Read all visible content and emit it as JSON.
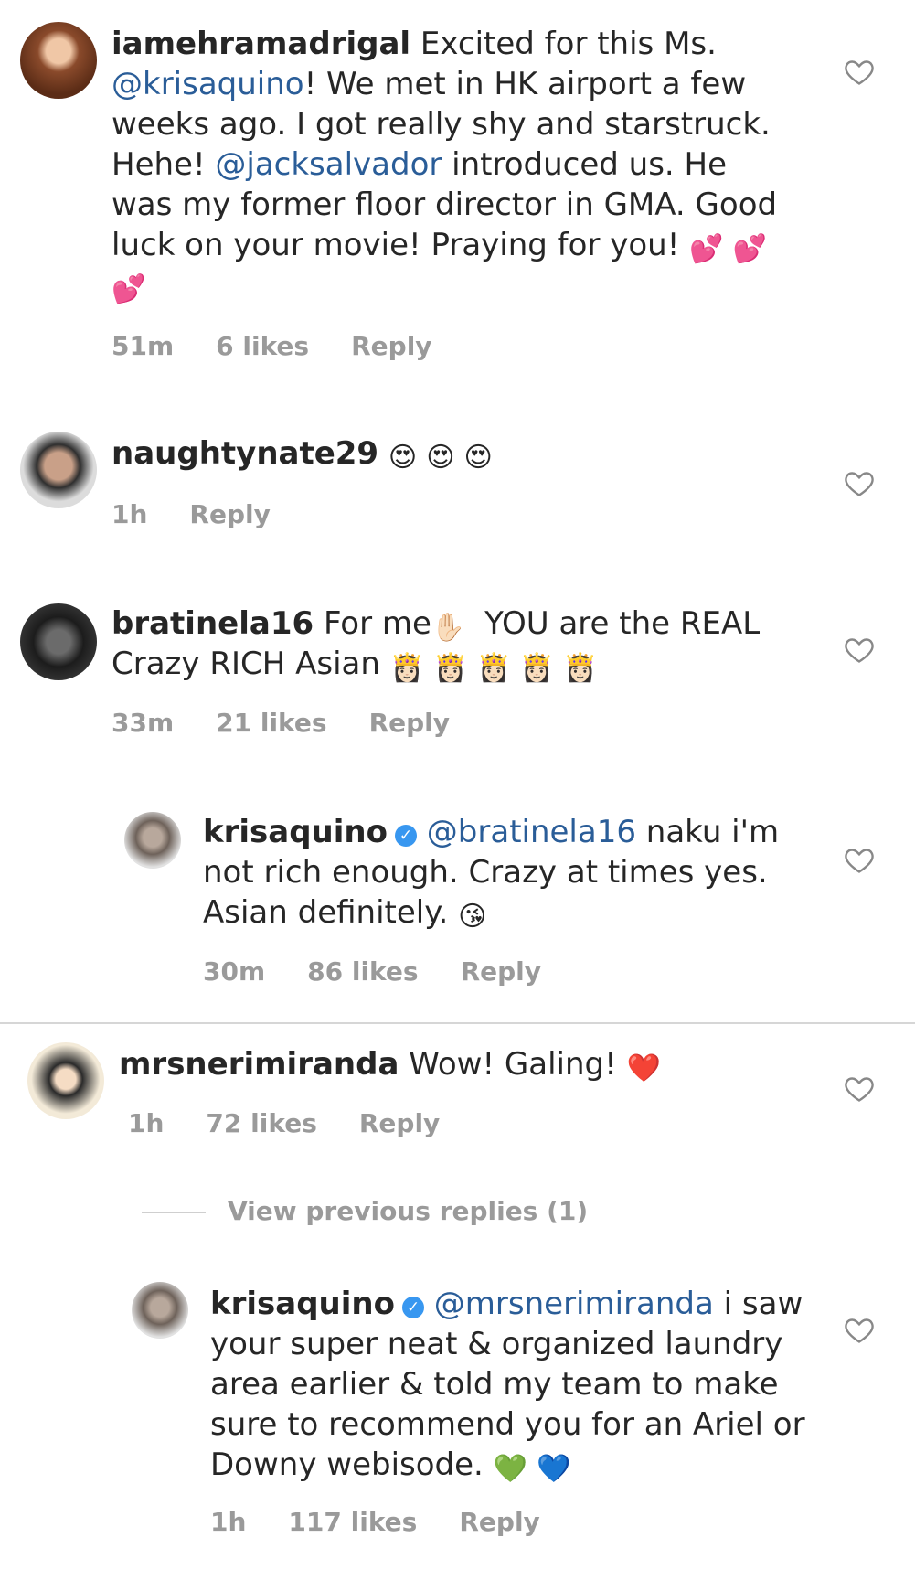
{
  "comments": [
    {
      "username": "iamehramadrigal",
      "text_a": " Excited for this Ms. ",
      "mention": "@krisaquino",
      "text_b": "! We met in HK airport a few weeks ago. I got really shy and starstruck. Hehe! ",
      "mention2": "@jacksalvador",
      "text_c": " introduced us. He was my former floor director in GMA. Good luck on your movie! Praying for you!",
      "emoji": [
        "💕",
        "💕",
        "💕"
      ],
      "time": "51m",
      "likes": "6 likes",
      "reply": "Reply"
    },
    {
      "username": "naughtynate29",
      "emoji": [
        "😍",
        "😍",
        "😍"
      ],
      "time": "1h",
      "reply": "Reply"
    },
    {
      "username": "bratinela16",
      "text_a": " For me",
      "emoji_a": "✋🏻",
      "text_b": " YOU are the REAL Crazy RICH Asian",
      "emoji": [
        "👸🏻",
        "👸🏻",
        "👸🏻",
        "👸🏻",
        "👸🏻"
      ],
      "time": "33m",
      "likes": "21 likes",
      "reply": "Reply"
    },
    {
      "username": "krisaquino",
      "verified_icon": "verified-check-icon",
      "mention": "@bratinela16",
      "text_a": " naku i'm not rich enough. Crazy at times yes. Asian definitely.",
      "emoji": [
        "😘"
      ],
      "time": "30m",
      "likes": "86 likes",
      "reply": "Reply"
    },
    {
      "username": "mrsnerimiranda",
      "text_a": " Wow! Galing!",
      "emoji": [
        "❤️"
      ],
      "time": "1h",
      "likes": "72 likes",
      "reply": "Reply"
    },
    {
      "username": "krisaquino",
      "verified_icon": "verified-check-icon",
      "mention": "@mrsnerimiranda",
      "text_a": " i saw your super neat & organized laundry area earlier & told my team to make sure to recommend you for an Ariel or Downy webisode.",
      "emoji": [
        "💚",
        "💙"
      ],
      "time": "1h",
      "likes": "117 likes",
      "reply": "Reply"
    }
  ],
  "view_previous_replies": "View previous replies (1)",
  "colors": {
    "mention": "#2a5d98",
    "meta": "#9a9a9a",
    "verified": "#3897f0"
  }
}
